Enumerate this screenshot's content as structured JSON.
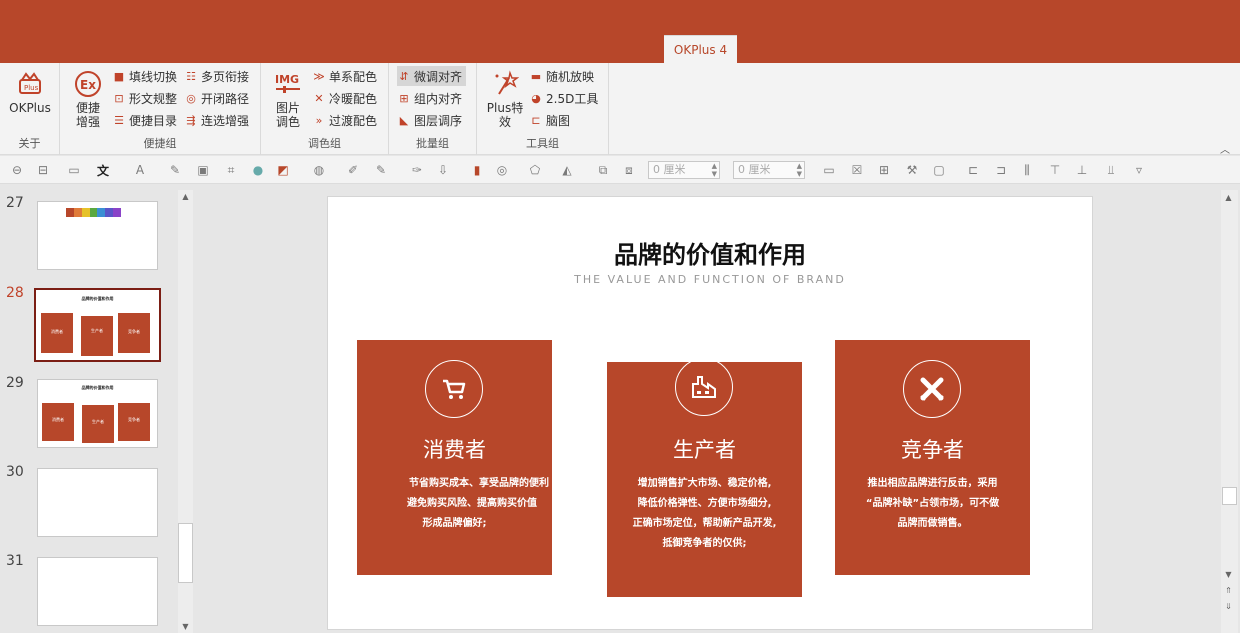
{
  "tab": {
    "label": "OKPlus 4"
  },
  "ribbon": {
    "about": {
      "btn_label": "OKPlus",
      "group_label": "关于"
    },
    "quick": {
      "enhance_line1": "便捷",
      "enhance_line2": "增强",
      "items": [
        "填线切换",
        "形文规整",
        "便捷目录",
        "多页衔接",
        "开闭路径",
        "连选增强"
      ],
      "group_label": "便捷组"
    },
    "color": {
      "img_line1": "图片",
      "img_line2": "调色",
      "items": [
        "单系配色",
        "冷暖配色",
        "过渡配色"
      ],
      "group_label": "调色组"
    },
    "batch": {
      "items": [
        "微调对齐",
        "组内对齐",
        "图层调序"
      ],
      "group_label": "批量组"
    },
    "tools": {
      "plus_line1": "Plus特",
      "plus_line2": "效",
      "items": [
        "随机放映",
        "2.5D工具",
        "脑图"
      ],
      "group_label": "工具组"
    }
  },
  "toolbar2": {
    "field1": "0 厘米",
    "field2": "0 厘米"
  },
  "thumbnails": [
    {
      "num": "27"
    },
    {
      "num": "28",
      "active": true,
      "title": "品牌的价值和作用"
    },
    {
      "num": "29",
      "title": "品牌的价值和作用"
    },
    {
      "num": "30"
    },
    {
      "num": "31"
    }
  ],
  "thumb_labels": {
    "c1": "消费者",
    "c2": "生产者",
    "c3": "竞争者"
  },
  "slide": {
    "title": "品牌的价值和作用",
    "subtitle": "THE VALUE AND FUNCTION OF BRAND",
    "cards": [
      {
        "title": "消费者",
        "icon": "cart-icon",
        "lines": [
          "节省购买成本、享受品牌的便利",
          "避免购买风险、提高购买价值",
          "形成品牌偏好;"
        ]
      },
      {
        "title": "生产者",
        "icon": "factory-icon",
        "lines": [
          "增加销售扩大市场、稳定价格,",
          "降低价格弹性、方便市场细分,",
          "正确市场定位，帮助新产品开发,",
          "抵御竞争者的仅供;"
        ]
      },
      {
        "title": "竞争者",
        "icon": "crossed-swords-icon",
        "lines": [
          "推出相应品牌进行反击，采用",
          "“品牌补缺”占领市场，可不做",
          "品牌而做销售。"
        ]
      }
    ]
  },
  "colors": {
    "accent": "#b7472a",
    "active_thumb_border": "#7b1e14"
  }
}
